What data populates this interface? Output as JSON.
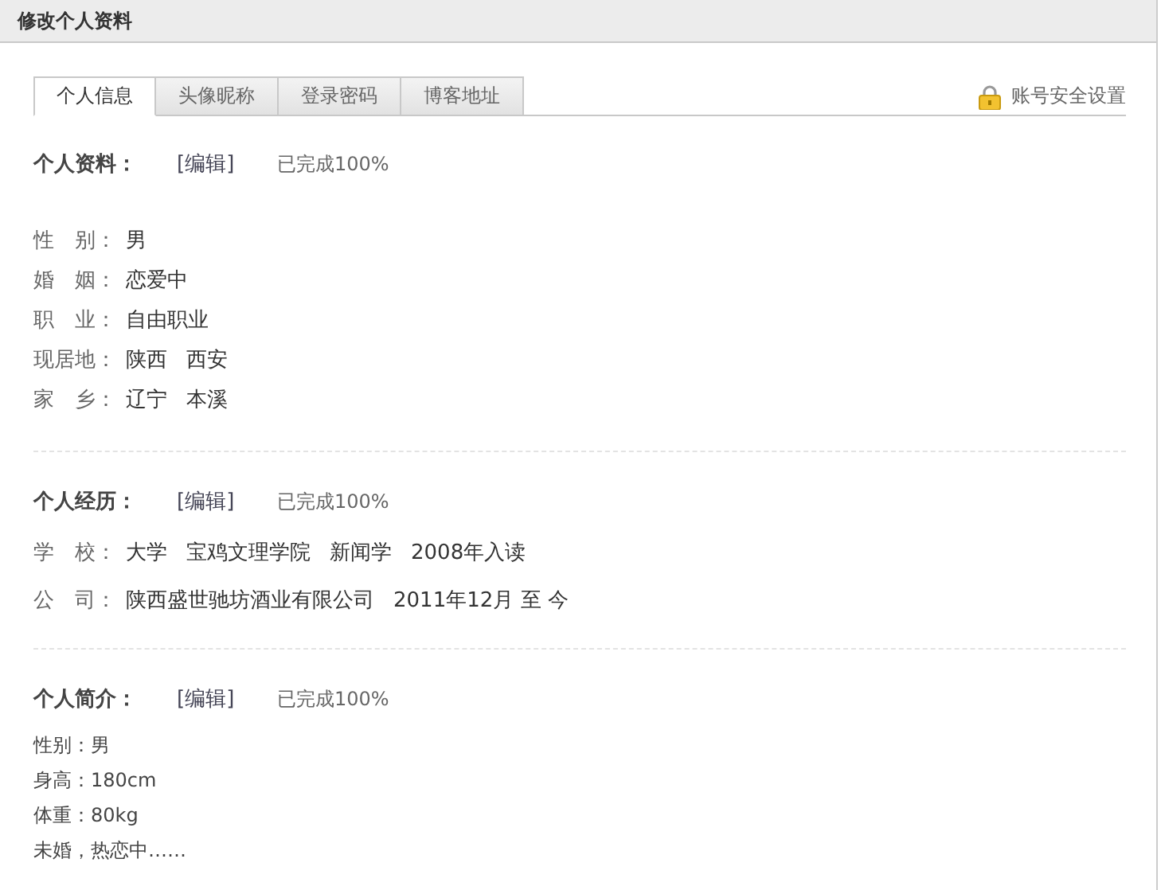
{
  "header": {
    "title": "修改个人资料"
  },
  "tabs": [
    {
      "label": "个人信息",
      "selected": true
    },
    {
      "label": "头像昵称",
      "selected": false
    },
    {
      "label": "登录密码",
      "selected": false
    },
    {
      "label": "博客地址",
      "selected": false
    }
  ],
  "security_link": "账号安全设置",
  "sections": [
    {
      "kind": "fields",
      "title": "个人资料：",
      "edit_link": "[编辑]",
      "completion": "已完成100%",
      "rows": [
        {
          "label": "性　别：",
          "values": [
            "男"
          ]
        },
        {
          "label": "婚　姻：",
          "values": [
            "恋爱中"
          ]
        },
        {
          "label": "职　业：",
          "values": [
            "自由职业"
          ]
        },
        {
          "label": "现居地：",
          "values": [
            "陕西",
            "西安"
          ]
        },
        {
          "label": "家　乡：",
          "values": [
            "辽宁",
            "本溪"
          ]
        }
      ]
    },
    {
      "kind": "history",
      "title": "个人经历：",
      "edit_link": "[编辑]",
      "completion": "已完成100%",
      "rows": [
        {
          "label": "学　校：",
          "values": [
            "大学",
            "宝鸡文理学院",
            "新闻学",
            "2008年入读"
          ]
        },
        {
          "label": "公　司：",
          "values": [
            "陕西盛世驰坊酒业有限公司",
            "2011年12月 至 今"
          ]
        }
      ]
    },
    {
      "kind": "lines",
      "title": "个人简介：",
      "edit_link": "[编辑]",
      "completion": "已完成100%",
      "lines": [
        "性别：男",
        "身高：180cm",
        "体重：80kg",
        "未婚，热恋中……"
      ]
    }
  ]
}
